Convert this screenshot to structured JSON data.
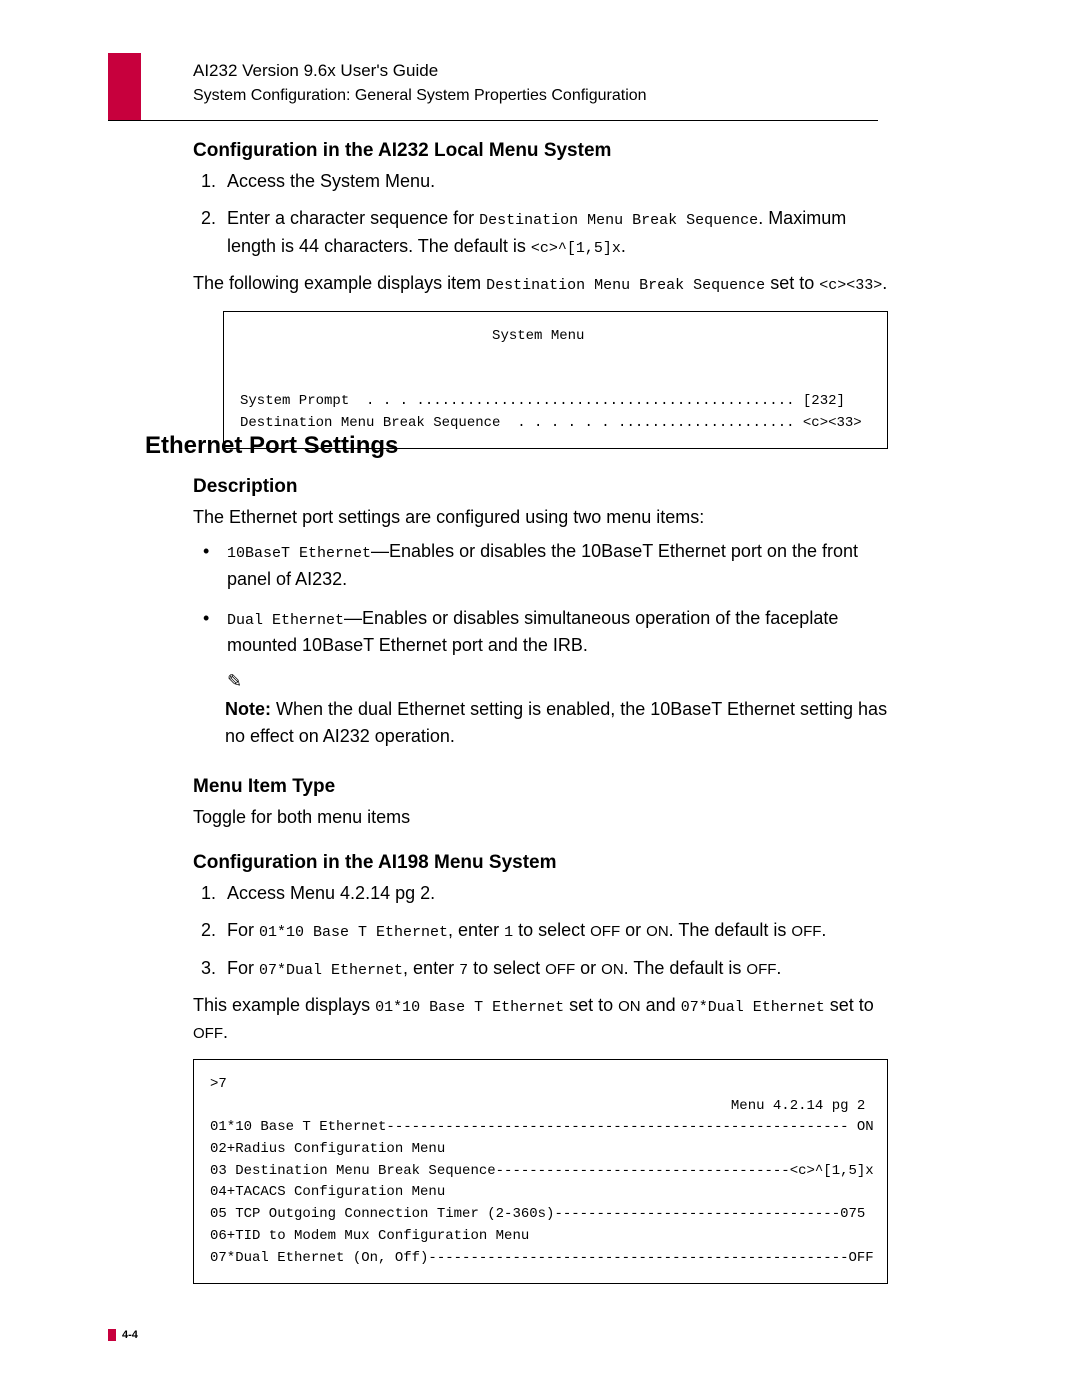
{
  "header": {
    "title": "AI232 Version 9.6x User's Guide",
    "subtitle": "System Configuration: General System Properties Configuration"
  },
  "sec1": {
    "h3": "Configuration in the AI232 Local Menu System",
    "li1": "Access the System Menu.",
    "li2a": "Enter a character sequence for ",
    "li2_mono1": "Destination Menu Break Sequence",
    "li2b": ". Maximum length is 44 characters. The default is ",
    "li2_mono2": "<c>^[1,5]x",
    "li2c": ".",
    "p1a": "The following example displays item ",
    "p1_mono1": "Destination Menu Break Sequence",
    "p1b": " set to ",
    "p1_mono2": "<c><33>",
    "p1c": ".",
    "code": "                              System Menu\n\n\nSystem Prompt  . . . ............................................. [232]\nDestination Menu Break Sequence  . . . . . . ..................... <c><33>"
  },
  "sec2": {
    "h2": "Ethernet Port Settings",
    "desc_h3": "Description",
    "desc_p": "The Ethernet port settings are configured using two menu items:",
    "b1_mono": "10BaseT Ethernet",
    "b1_text": "—Enables or disables the 10BaseT Ethernet port on the front panel of AI232.",
    "b2_mono": "Dual Ethernet",
    "b2_text": "—Enables or disables simultaneous operation of the faceplate mounted 10BaseT Ethernet port and the IRB.",
    "pencil": "✎",
    "note_label": "Note:",
    "note_text": "  When the dual Ethernet setting is enabled, the 10BaseT Ethernet setting has no effect on AI232 operation.",
    "mit_h3": "Menu Item Type",
    "mit_p": "Toggle for both menu items",
    "cfg_h3": "Configuration in the AI198 Menu System",
    "c_li1": "Access Menu 4.2.14 pg 2.",
    "c_li2a": "For ",
    "c_li2_mono": "01*10 Base T Ethernet",
    "c_li2b": ", enter ",
    "c_li2_key": "1",
    "c_li2c": " to select ",
    "c_li2_off": "OFF",
    "c_li2d": " or ",
    "c_li2_on": "ON",
    "c_li2e": ". The default is ",
    "c_li2_off2": "OFF",
    "c_li2f": ".",
    "c_li3a": "For ",
    "c_li3_mono": "07*Dual Ethernet",
    "c_li3b": ", enter ",
    "c_li3_key": "7",
    "c_li3c": " to select ",
    "c_li3_off": "OFF",
    "c_li3d": " or ",
    "c_li3_on": "ON",
    "c_li3e": ". The default is ",
    "c_li3_off2": "OFF",
    "c_li3f": ".",
    "ex_a": "This example displays ",
    "ex_mono1": "01*10 Base T Ethernet",
    "ex_b": " set to ",
    "ex_on": "ON",
    "ex_c": " and ",
    "ex_mono2": "07*Dual Ethernet",
    "ex_d": " set to ",
    "ex_off": "OFF",
    "ex_e": ".",
    "code2": ">7\n                                                              Menu 4.2.14 pg 2\n01*10 Base T Ethernet------------------------------------------------------- ON\n02+Radius Configuration Menu\n03 Destination Menu Break Sequence-----------------------------------<c>^[1,5]x\n04+TACACS Configuration Menu\n05 TCP Outgoing Connection Timer (2-360s)----------------------------------075\n06+TID to Modem Mux Configuration Menu\n07*Dual Ethernet (On, Off)--------------------------------------------------OFF"
  },
  "footer": {
    "page": "4-4"
  }
}
